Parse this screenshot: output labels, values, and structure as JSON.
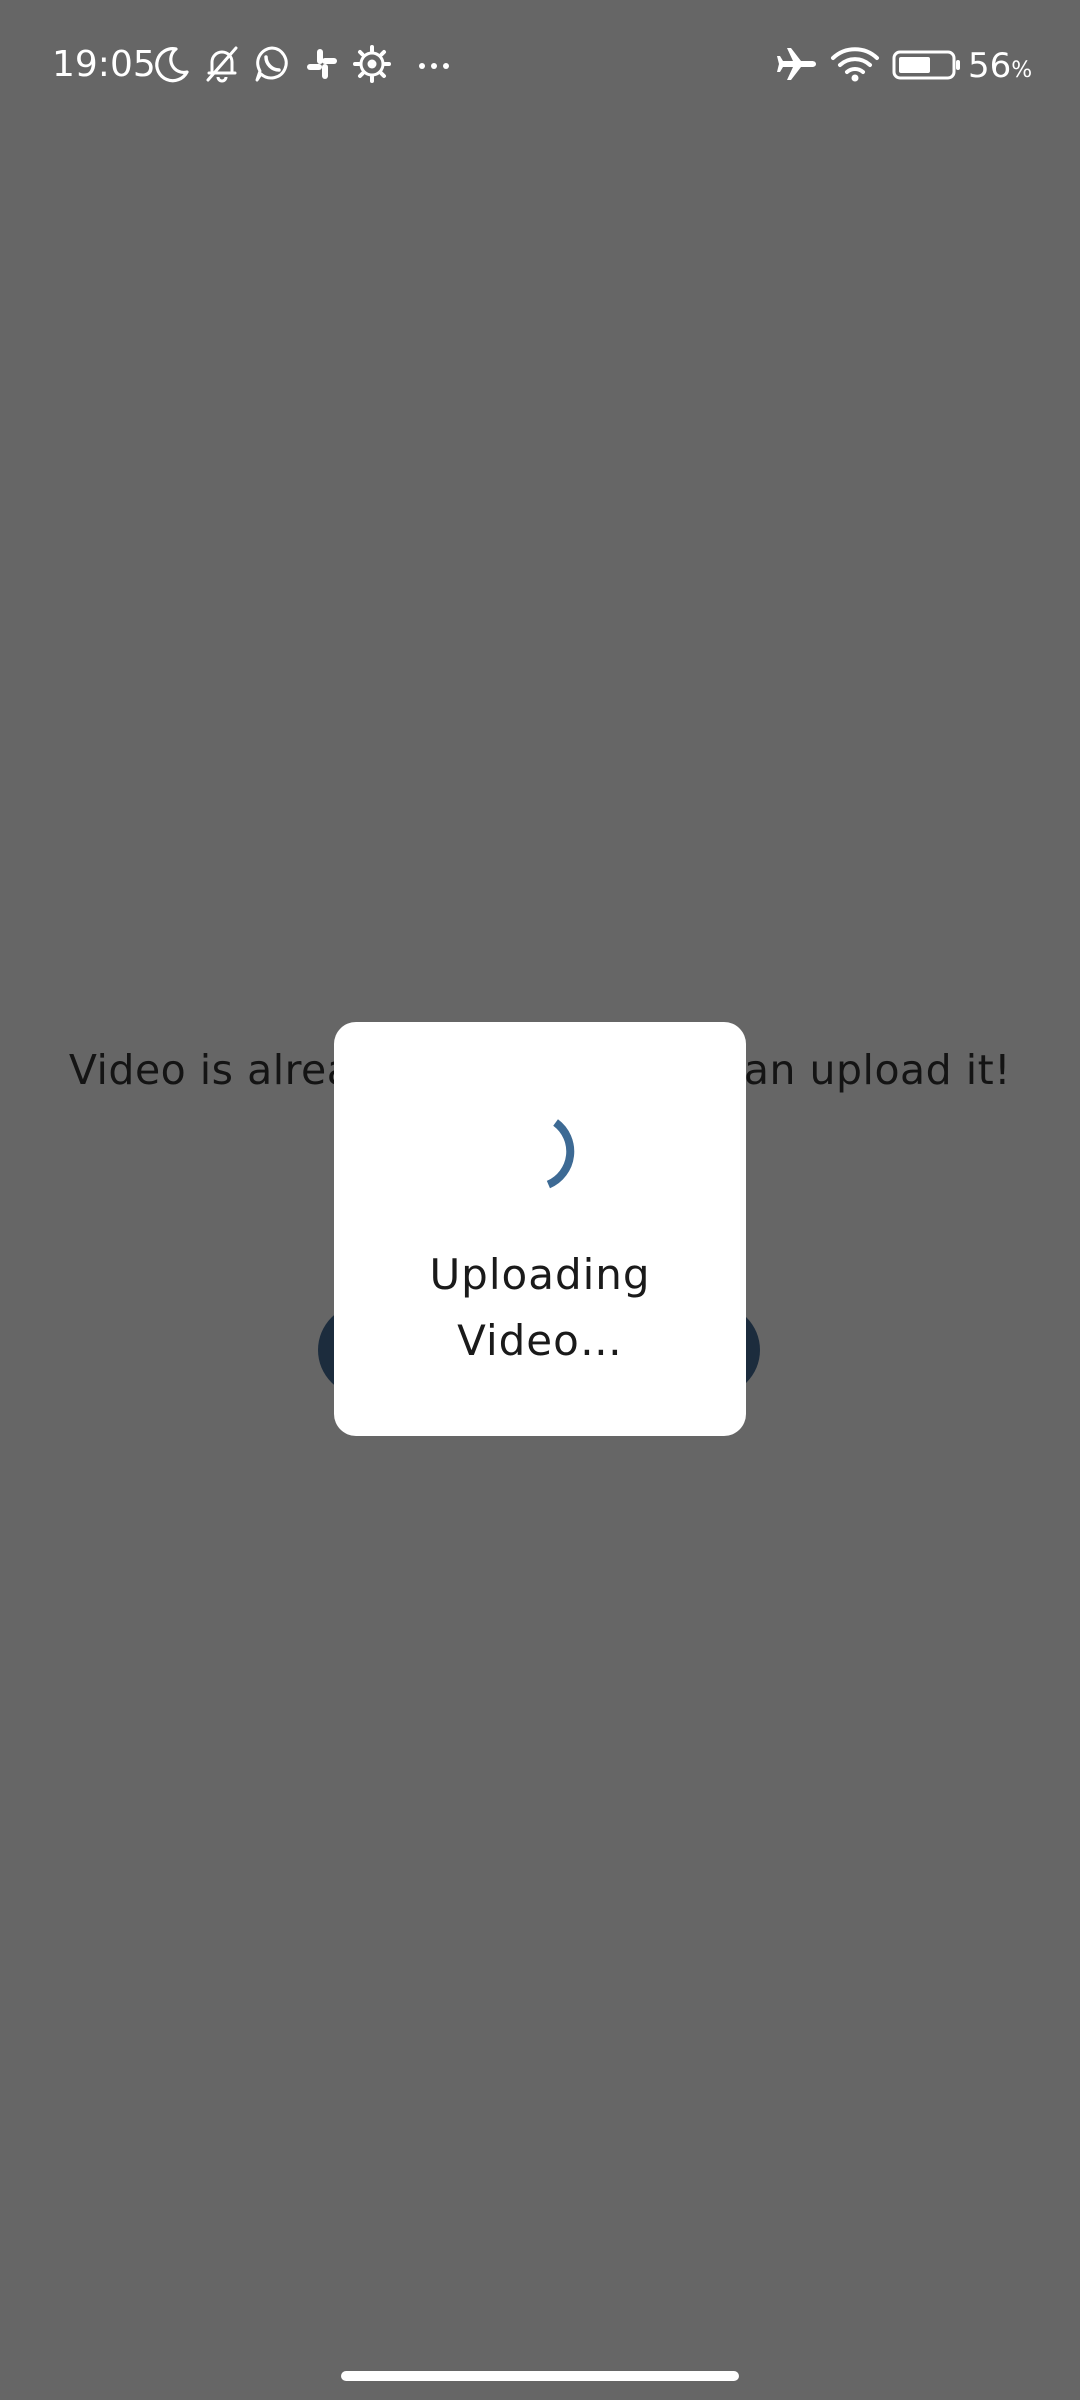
{
  "status_bar": {
    "time": "19:05",
    "battery_percent": "56",
    "battery_unit": "%",
    "left_icons": [
      "moon-icon",
      "bell-off-icon",
      "whatsapp-icon",
      "slack-icon",
      "settings-icon",
      "more-dots-icon"
    ],
    "right_icons": [
      "airplane-icon",
      "wifi-icon",
      "battery-icon"
    ]
  },
  "page": {
    "message": "Video is already recorded, you can upload it!",
    "overlay_color": "#666666"
  },
  "dialog": {
    "text_line1": "Uploading",
    "text_line2": "Video…",
    "spinner_color": "#3d6a94"
  }
}
